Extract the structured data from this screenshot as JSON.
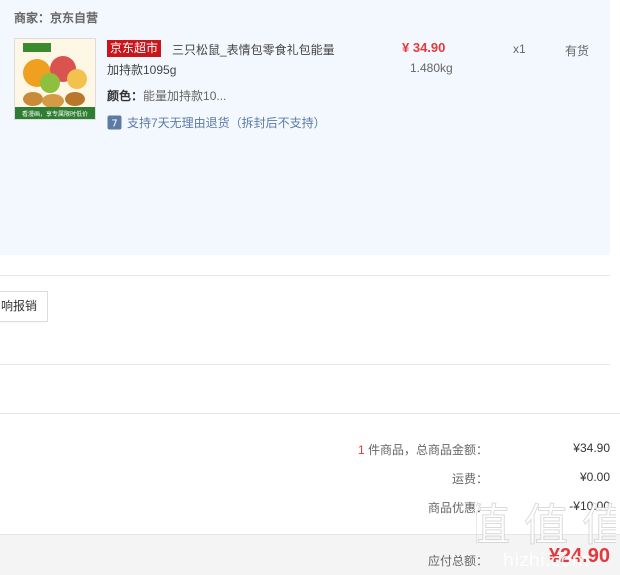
{
  "merchant": {
    "label": "商家：京东自营"
  },
  "item": {
    "tag": "京东超市",
    "title_line1": "三只松鼠_表情包零食礼包能量",
    "title_line2": "加持款1095g",
    "price": "¥ 34.90",
    "weight": "1.480kg",
    "quantity": "x1",
    "stock": "有货",
    "color_label": "颜色：",
    "color_value": "能量加持款10...",
    "return_policy": "支持7天无理由退货（拆封后不支持）",
    "thumbnail_caption": "看漫画，享专属限时低价"
  },
  "invoice_button": "响报销",
  "summary": {
    "count": "1",
    "items_label": " 件商品，总商品金额：",
    "items_value": "¥34.90",
    "shipping_label": "运费：",
    "shipping_value": "¥0.00",
    "discount_label": "商品优惠：",
    "discount_value": "-¥10.00",
    "total_label": "应付总额：",
    "total_value": "¥24.90"
  },
  "watermark": {
    "text": "值 值 值",
    "subtext": "hizhi.com"
  },
  "colors": {
    "accent_red": "#e4393c",
    "tag_red": "#c8161d",
    "panel_bg": "#f3f8fe",
    "link_blue": "#5d7aa6"
  }
}
